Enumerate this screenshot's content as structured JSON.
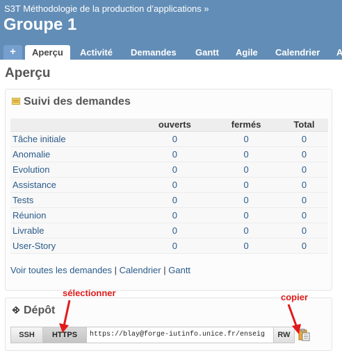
{
  "header": {
    "parent_project": "S3T Méthodologie de la production d’applications",
    "separator": "»",
    "title": "Groupe 1"
  },
  "tabs": [
    {
      "label": "+"
    },
    {
      "label": "Aperçu",
      "selected": true
    },
    {
      "label": "Activité"
    },
    {
      "label": "Demandes"
    },
    {
      "label": "Gantt"
    },
    {
      "label": "Agile"
    },
    {
      "label": "Calendrier"
    },
    {
      "label": "A"
    }
  ],
  "page_title": "Aperçu",
  "issues": {
    "title": "Suivi des demandes",
    "columns": [
      "",
      "ouverts",
      "fermés",
      "Total"
    ],
    "rows": [
      {
        "name": "Tâche initiale",
        "open": "0",
        "closed": "0",
        "total": "0"
      },
      {
        "name": "Anomalie",
        "open": "0",
        "closed": "0",
        "total": "0"
      },
      {
        "name": "Evolution",
        "open": "0",
        "closed": "0",
        "total": "0"
      },
      {
        "name": "Assistance",
        "open": "0",
        "closed": "0",
        "total": "0"
      },
      {
        "name": "Tests",
        "open": "0",
        "closed": "0",
        "total": "0"
      },
      {
        "name": "Réunion",
        "open": "0",
        "closed": "0",
        "total": "0"
      },
      {
        "name": "Livrable",
        "open": "0",
        "closed": "0",
        "total": "0"
      },
      {
        "name": "User-Story",
        "open": "0",
        "closed": "0",
        "total": "0"
      }
    ],
    "links": {
      "all_issues": "Voir toutes les demandes",
      "calendar": "Calendrier",
      "gantt": "Gantt",
      "separator": "|"
    }
  },
  "repository": {
    "title": "Dépôt",
    "ssh_label": "SSH",
    "https_label": "HTTPS",
    "url": "https://blay@forge-iutinfo.unice.fr/enseig",
    "rw_label": "RW"
  },
  "annotations": {
    "select": "sélectionner",
    "copy": "copier"
  },
  "colors": {
    "header": "#628db6",
    "annotation": "#e01b1b",
    "link": "#2a5a8a"
  }
}
